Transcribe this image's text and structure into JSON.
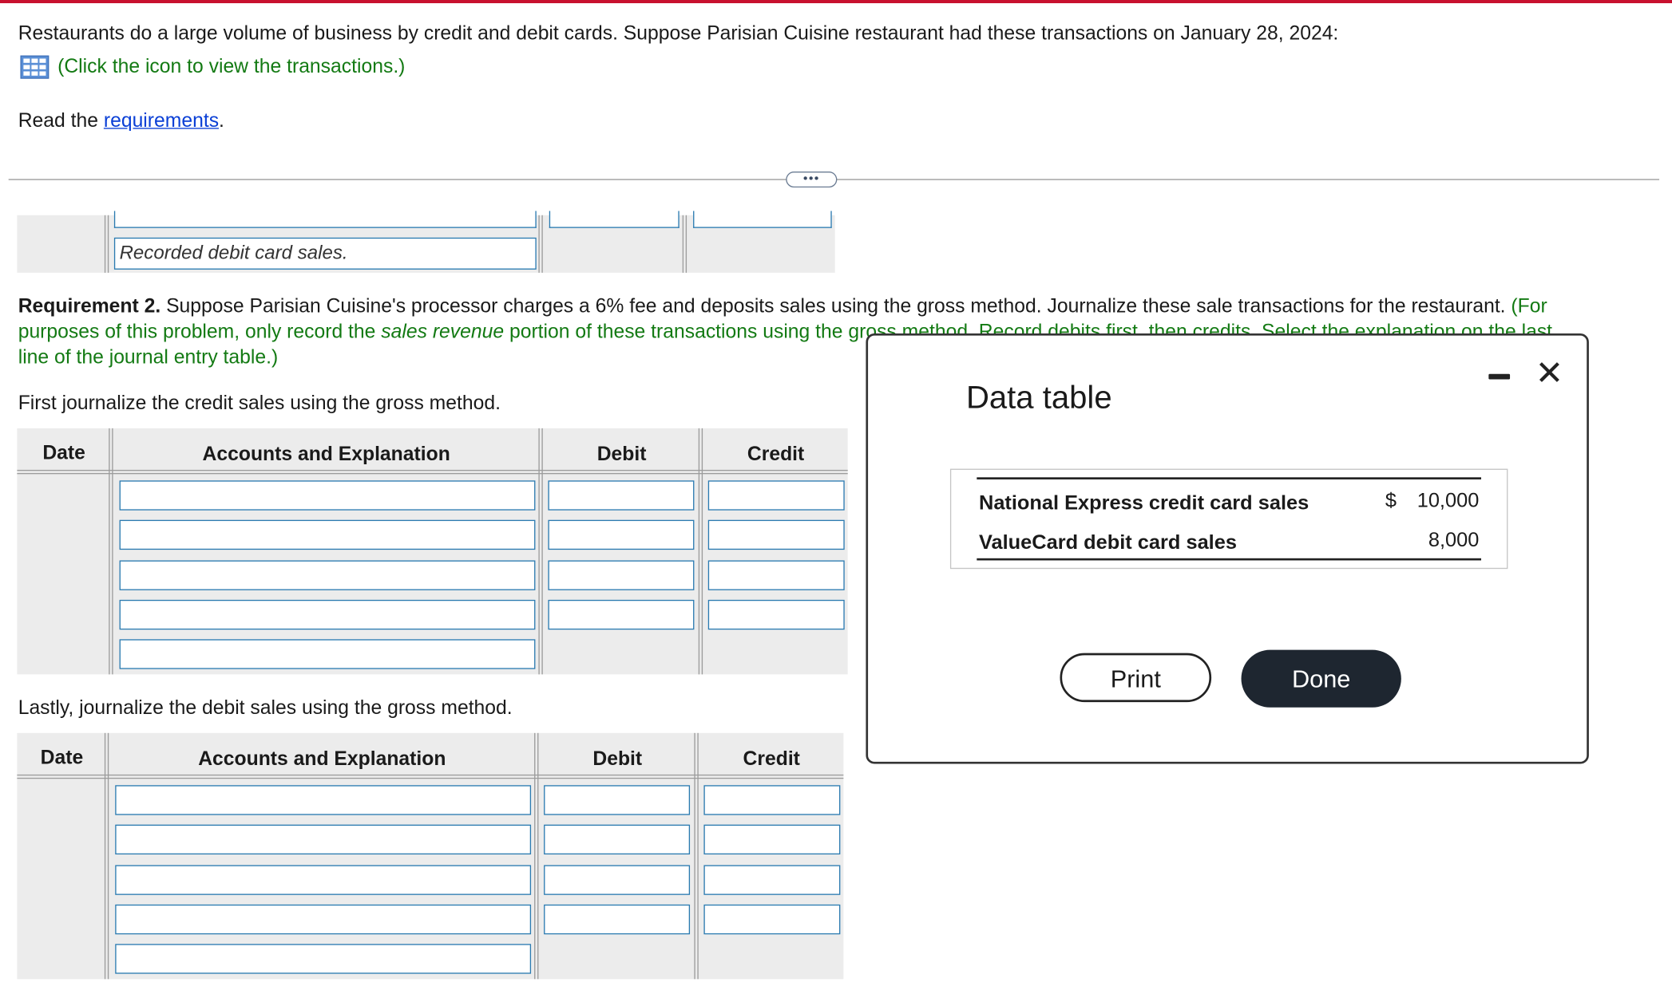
{
  "intro": {
    "text": "Restaurants do a large volume of business by credit and debit cards. Suppose Parisian Cuisine restaurant had these transactions on January 28, 2024:",
    "click_icon_text": "(Click the icon to view the transactions.)",
    "read_the": "Read the",
    "requirements_link": "requirements",
    "period": "."
  },
  "prior_entry": {
    "explanation": "Recorded debit card sales."
  },
  "requirement2": {
    "label": "Requirement 2.",
    "text": " Suppose Parisian Cuisine's processor charges a 6% fee and deposits sales using the gross method. Journalize these sale transactions for the restaurant.",
    "green_1": " (For",
    "green_2a": "purposes of this problem, only record the ",
    "green_2b": "sales revenue",
    "green_2c": " portion of these transactions using the gross method. Record debits first, then credits. Select the explanation on the last",
    "green_3": "line of the journal entry table.)"
  },
  "credit_section": {
    "instruction": "First journalize the credit sales using the gross method.",
    "headers": {
      "date": "Date",
      "accounts": "Accounts and Explanation",
      "debit": "Debit",
      "credit": "Credit"
    }
  },
  "debit_section": {
    "instruction": "Lastly, journalize the debit sales using the gross method.",
    "headers": {
      "date": "Date",
      "accounts": "Accounts and Explanation",
      "debit": "Debit",
      "credit": "Credit"
    }
  },
  "modal": {
    "title": "Data table",
    "rows": [
      {
        "label": "National Express credit card sales",
        "currency": "$",
        "value": "10,000"
      },
      {
        "label": "ValueCard debit card sales",
        "currency": "",
        "value": "8,000"
      }
    ],
    "print_label": "Print",
    "done_label": "Done"
  },
  "colors": {
    "accent_bar": "#c8102e",
    "green_text": "#137a13",
    "link": "#0a3fd6",
    "input_border": "#2a7ab0",
    "done_button": "#1e2630"
  }
}
